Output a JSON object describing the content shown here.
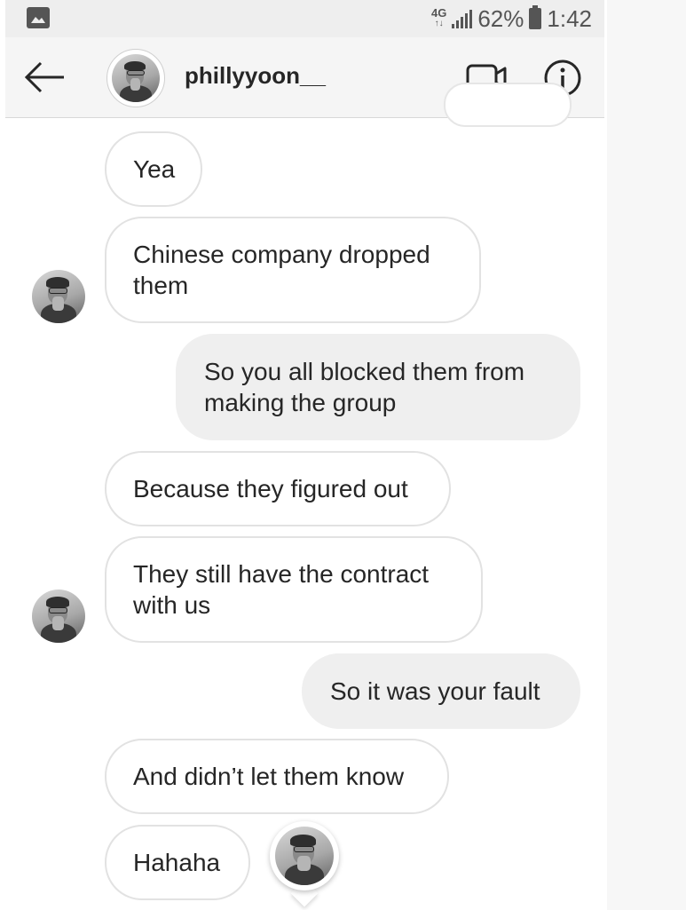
{
  "status_bar": {
    "network_top": "4G",
    "network_bottom": "↑↓",
    "battery_percent": "62%",
    "time": "1:42"
  },
  "header": {
    "username": "phillyyoon__"
  },
  "messages": [
    {
      "text": "Yea",
      "direction": "incoming"
    },
    {
      "text": "Chinese company dropped them",
      "direction": "incoming"
    },
    {
      "text": "So you all blocked them from making the group",
      "direction": "outgoing"
    },
    {
      "text": "Because they figured out",
      "direction": "incoming"
    },
    {
      "text": "They still have the contract with us",
      "direction": "incoming"
    },
    {
      "text": "So it was your fault",
      "direction": "outgoing"
    },
    {
      "text": "And didn’t let them know",
      "direction": "incoming"
    },
    {
      "text": "Hahaha",
      "direction": "incoming"
    }
  ],
  "colors": {
    "incoming_bg": "#ffffff",
    "incoming_border": "#e2e2e2",
    "outgoing_bg": "#efefef",
    "text": "#262626",
    "header_bg": "#f5f5f5",
    "status_bar_bg": "#eeeeee"
  },
  "icons": {
    "status_left": "gallery-icon",
    "back": "arrow-left-icon",
    "video": "video-camera-icon",
    "info": "info-icon",
    "battery": "battery-icon",
    "signal": "signal-icon"
  }
}
